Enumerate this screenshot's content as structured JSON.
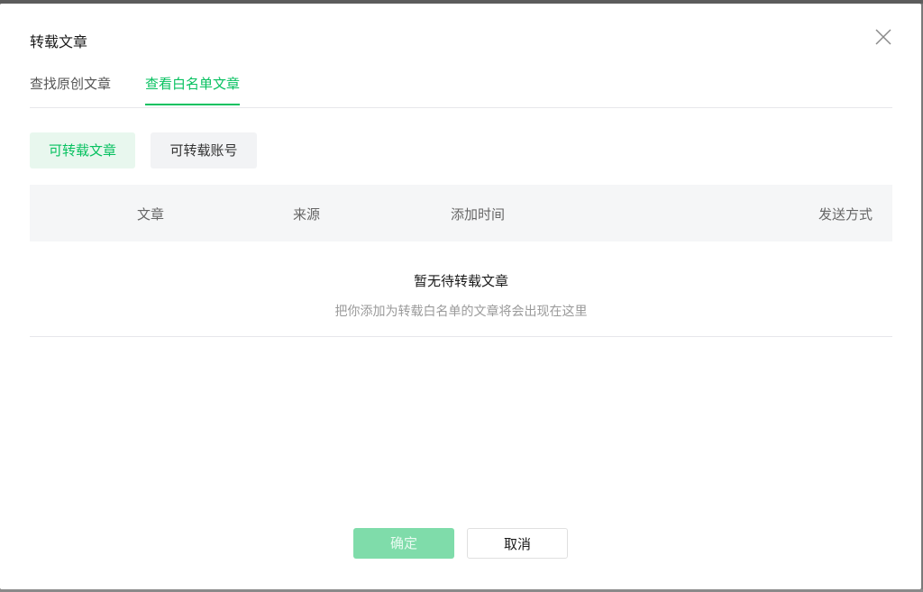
{
  "dialog": {
    "title": "转载文章",
    "close_icon": "close-icon"
  },
  "tabs": [
    {
      "label": "查找原创文章",
      "active": false
    },
    {
      "label": "查看白名单文章",
      "active": true
    }
  ],
  "subtabs": [
    {
      "label": "可转载文章",
      "selected": true
    },
    {
      "label": "可转载账号",
      "selected": false
    }
  ],
  "table": {
    "columns": [
      "文章",
      "来源",
      "添加时间",
      "发送方式"
    ]
  },
  "empty_state": {
    "title": "暂无待转载文章",
    "description": "把你添加为转载白名单的文章将会出现在这里"
  },
  "footer": {
    "confirm_label": "确定",
    "cancel_label": "取消"
  },
  "colors": {
    "accent": "#07c160",
    "accent_light_bg": "#e8f7ee",
    "disabled_primary": "#7fdcaa"
  }
}
